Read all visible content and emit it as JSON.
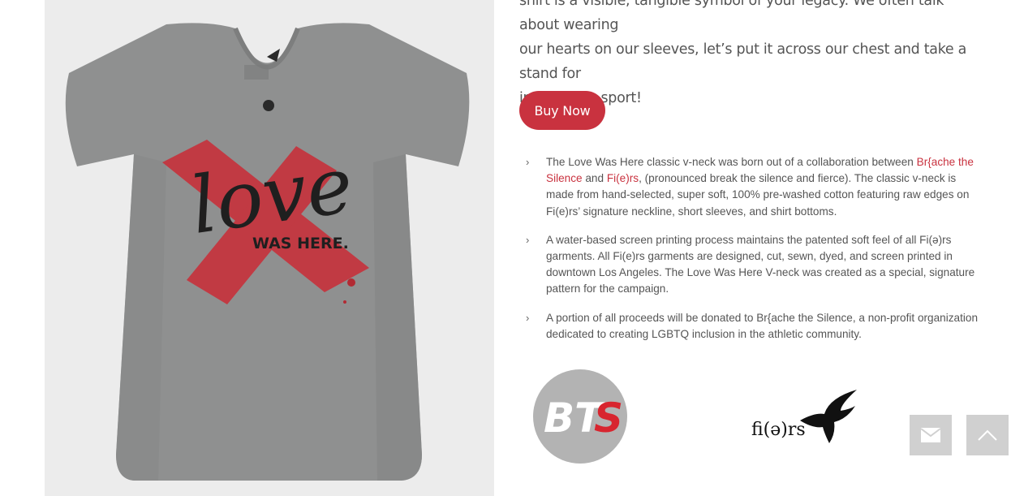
{
  "intro": {
    "line1": "shirt is a visible, tangible symbol of your legacy. We often talk about wearing",
    "line2": "our hearts on our sleeves, let’s put it across our chest and take a stand for",
    "line3": "inclusion in sport!"
  },
  "buy_button": "Buy Now",
  "features": [
    {
      "text_a": "The Love Was Here classic v-neck was born out of a collaboration between ",
      "link1": "Br{ache the Silence",
      "text_b": " and ",
      "link2": "Fi(e)rs",
      "text_c": ", (pronounced break the silence and fierce). The classic v-neck is made from hand-selected, super soft, 100% pre-washed cotton featuring raw edges on Fi(e)rs’ signature neckline, short sleeves, and shirt bottoms."
    },
    {
      "text": "A water-based screen printing process maintains the patented soft feel of all Fi(ə)rs garments. All Fi(e)rs garments are designed, cut, sewn, dyed, and screen printed in downtown Los Angeles. The Love Was Here V-neck was created as a special, signature pattern for the campaign."
    },
    {
      "text": "A portion of all proceeds will be donated to Br{ache the Silence, a non-profit organization dedicated to creating LGBTQ inclusion in the athletic community."
    }
  ],
  "shirt_print": {
    "script_word": "love",
    "tagline": "WAS HERE."
  },
  "logos": {
    "bts_text_1": "BT",
    "bts_text_2": "S",
    "fiers_text": "fi(ə)rs"
  },
  "icons": {
    "chevron": "chevron-right-icon",
    "contact": "envelope-icon",
    "top": "chevron-up-icon"
  },
  "colors": {
    "accent": "#c9323f",
    "float_button": "#d0d0d0"
  }
}
